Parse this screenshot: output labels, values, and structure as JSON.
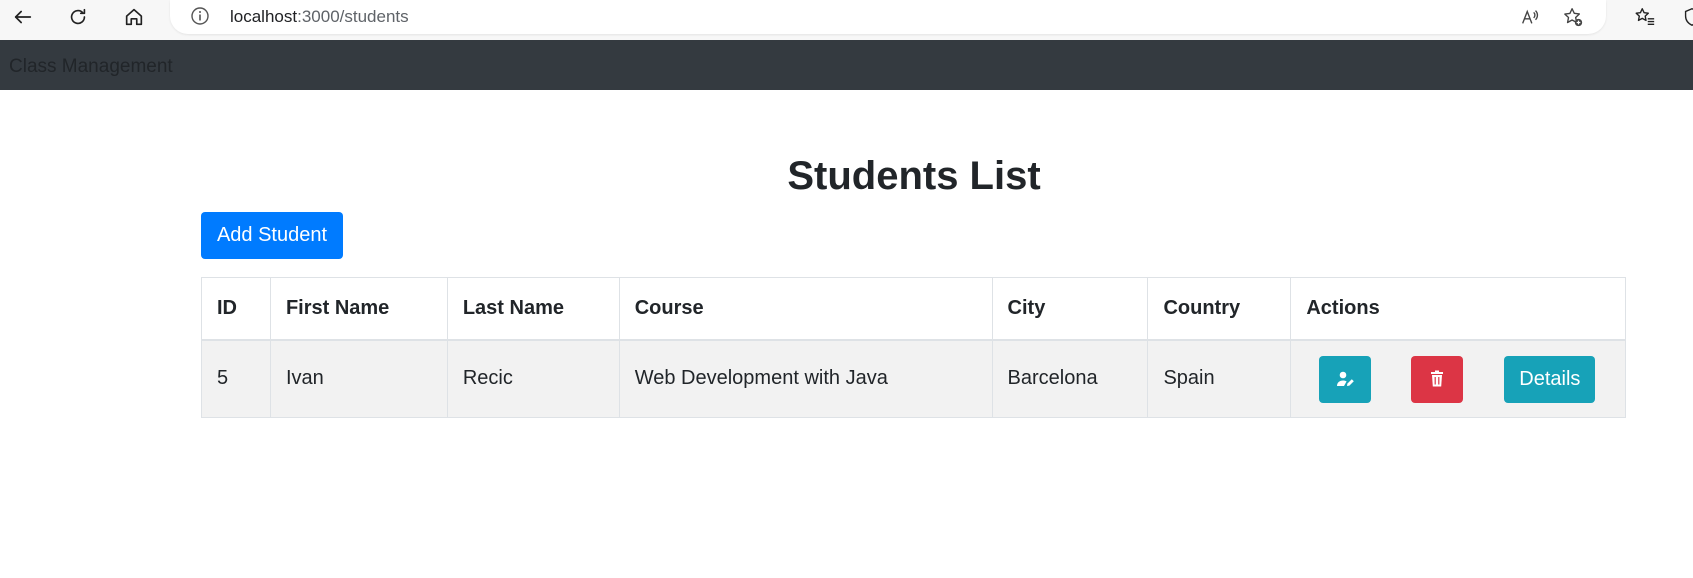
{
  "browser": {
    "url_host": "localhost",
    "url_rest": ":3000/students",
    "icons": [
      "back-icon",
      "refresh-icon",
      "home-icon",
      "info-icon",
      "read-aloud-icon",
      "add-favorite-icon",
      "favorites-icon",
      "browser-essentials-icon"
    ]
  },
  "navbar": {
    "brand": "Class Management"
  },
  "main": {
    "title": "Students List",
    "add_button_label": "Add Student"
  },
  "table": {
    "headers": {
      "id": "ID",
      "first_name": "First Name",
      "last_name": "Last Name",
      "course": "Course",
      "city": "City",
      "country": "Country",
      "actions": "Actions"
    },
    "rows": [
      {
        "id": "5",
        "first_name": "Ivan",
        "last_name": "Recic",
        "course": "Web Development with Java",
        "city": "Barcelona",
        "country": "Spain",
        "details_label": "Details"
      }
    ]
  },
  "colors": {
    "navbar_bg": "#343a40",
    "primary": "#007bff",
    "info": "#17a2b8",
    "danger": "#dc3545",
    "row_striped": "#f2f2f2"
  }
}
